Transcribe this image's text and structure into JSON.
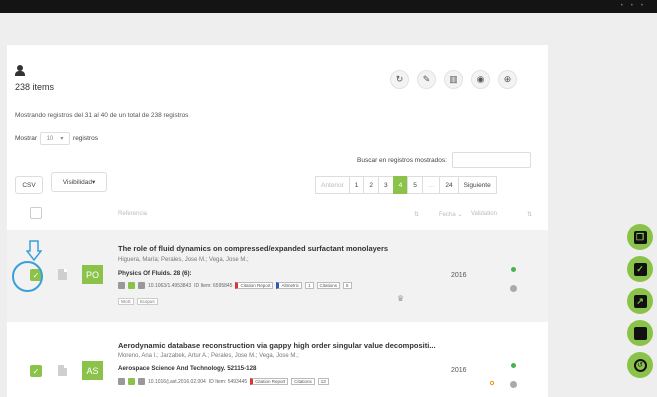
{
  "items_count": "238 items",
  "showing_text": "Mostrando registros del 31 al 40 de un total de 238 registros",
  "length": {
    "before": "Mostrar",
    "value": "10",
    "after": "registros"
  },
  "search_label": "Buscar en registros mostrados:",
  "csv_label": "CSV",
  "visibility_label": "Visibilidad",
  "pagination": [
    "Anterior",
    "1",
    "2",
    "3",
    "4",
    "5",
    "…",
    "24",
    "Siguiente"
  ],
  "columns": {
    "reference": "Referencia",
    "date": "Fecha",
    "validation": "Validation"
  },
  "rows": [
    {
      "tag": "PO",
      "title": "The role of fluid dynamics on compressed/expanded surfactant monolayers",
      "authors": "Higuera, María; Perales, Jose M.; Vega, Jose M.;",
      "journal": "Physics Of Fluids. 28 (6):",
      "doi": "10.1063/1.4953843",
      "item_id": "ID Item: 6595845",
      "mendeley": "Citation Report",
      "altmetric": "Altmetric",
      "altmetric_count": "1",
      "citations": "Citations",
      "citations_count": "5",
      "chips": [
        "WoS",
        "Scopus"
      ],
      "year": "2016"
    },
    {
      "tag": "AS",
      "title": "Aerodynamic database reconstruction via gappy high order singular value decompositi...",
      "authors": "Moreno, Ana I.; Jarzabek, Artur A.; Perales, Jose M.; Vega, Jose M.;",
      "journal": "Aerospace Science And Technology. 52115-128",
      "doi": "10.1016/j.ast.2016.02.004",
      "item_id": "ID Item: 5493445",
      "mendeley": "Citation Report",
      "citations": "Citations",
      "citations_count": "13",
      "year": "2016"
    }
  ],
  "colors": {
    "accent": "#8bc34a",
    "highlight": "#3aa0d8"
  }
}
